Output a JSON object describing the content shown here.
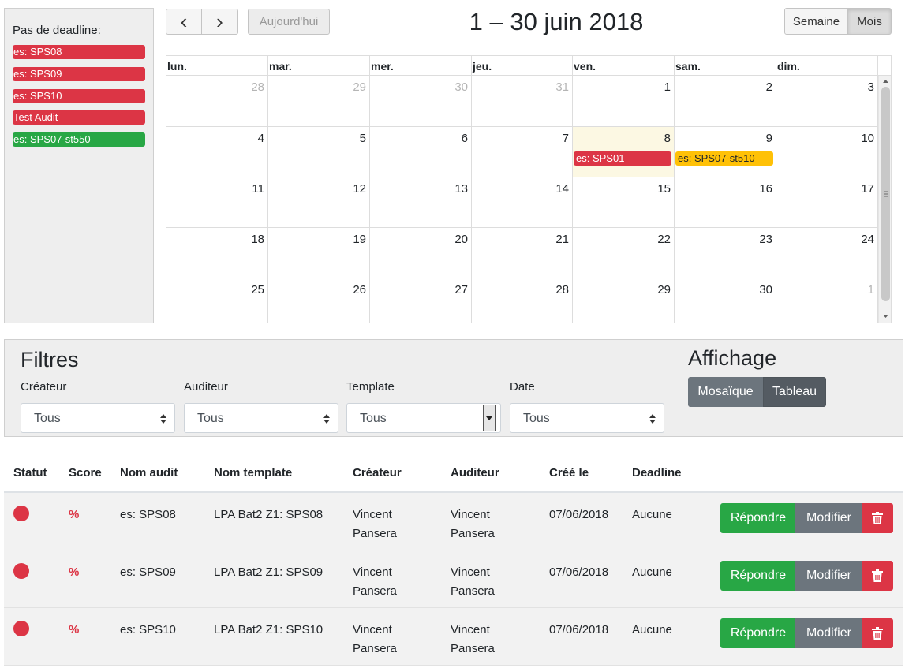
{
  "sidebar": {
    "title": "Pas de deadline:",
    "events": [
      {
        "label": "es: SPS08",
        "color": "#dc3545"
      },
      {
        "label": "es: SPS09",
        "color": "#dc3545"
      },
      {
        "label": "es: SPS10",
        "color": "#dc3545"
      },
      {
        "label": "Test Audit",
        "color": "#dc3545"
      },
      {
        "label": "es: SPS07-st550",
        "color": "#28a745"
      }
    ]
  },
  "toolbar": {
    "prev_icon": "‹",
    "next_icon": "›",
    "today_label": "Aujourd'hui",
    "title": "1 – 30 juin 2018",
    "view_week": "Semaine",
    "view_month": "Mois"
  },
  "calendar": {
    "day_headers": [
      "lun.",
      "mar.",
      "mer.",
      "jeu.",
      "ven.",
      "sam.",
      "dim."
    ],
    "weeks": [
      [
        "28",
        "29",
        "30",
        "31",
        "1",
        "2",
        "3"
      ],
      [
        "4",
        "5",
        "6",
        "7",
        "8",
        "9",
        "10"
      ],
      [
        "11",
        "12",
        "13",
        "14",
        "15",
        "16",
        "17"
      ],
      [
        "18",
        "19",
        "20",
        "21",
        "22",
        "23",
        "24"
      ],
      [
        "25",
        "26",
        "27",
        "28",
        "29",
        "30",
        "1"
      ]
    ],
    "events": [
      {
        "label": "es: SPS01",
        "color": "#dc3545"
      },
      {
        "label": "es: SPS07-st510",
        "color": "#ffc107"
      }
    ],
    "today_highlight": "#fcf8e3"
  },
  "filters": {
    "title": "Filtres",
    "fields": [
      {
        "label": "Créateur",
        "value": "Tous"
      },
      {
        "label": "Auditeur",
        "value": "Tous"
      },
      {
        "label": "Template",
        "value": "Tous"
      },
      {
        "label": "Date",
        "value": "Tous"
      }
    ],
    "display_title": "Affichage",
    "display_options": [
      "Mosaïque",
      "Tableau"
    ]
  },
  "table": {
    "headers": [
      "Statut",
      "Score",
      "Nom audit",
      "Nom template",
      "Créateur",
      "Auditeur",
      "Créé le",
      "Deadline"
    ],
    "rows": [
      {
        "score": "%",
        "name": "es: SPS08",
        "template": "LPA Bat2 Z1: SPS08",
        "creator": [
          "Vincent",
          "Pansera"
        ],
        "auditor": [
          "Vincent",
          "Pansera"
        ],
        "created": "07/06/2018",
        "deadline": "Aucune"
      },
      {
        "score": "%",
        "name": "es: SPS09",
        "template": "LPA Bat2 Z1: SPS09",
        "creator": [
          "Vincent",
          "Pansera"
        ],
        "auditor": [
          "Vincent",
          "Pansera"
        ],
        "created": "07/06/2018",
        "deadline": "Aucune"
      },
      {
        "score": "%",
        "name": "es: SPS10",
        "template": "LPA Bat2 Z1: SPS10",
        "creator": [
          "Vincent",
          "Pansera"
        ],
        "auditor": [
          "Vincent",
          "Pansera"
        ],
        "created": "07/06/2018",
        "deadline": "Aucune"
      }
    ],
    "actions": {
      "answer": "Répondre",
      "edit": "Modifier",
      "delete_icon": "trash-icon"
    }
  },
  "colors": {
    "red": "#dc3545",
    "green": "#28a745",
    "yellow": "#ffc107",
    "gray": "#6c757d",
    "dark_gray": "#545b62"
  }
}
